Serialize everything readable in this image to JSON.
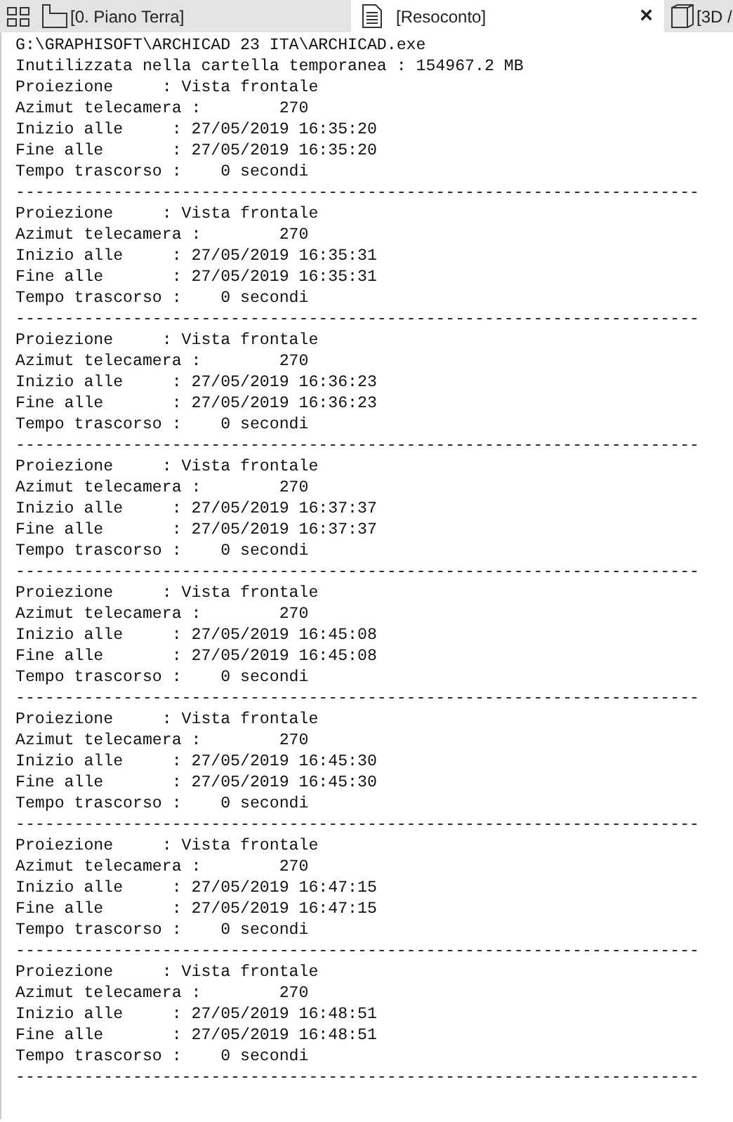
{
  "tabs": [
    {
      "kind": "plan",
      "label": "[0. Piano Terra]",
      "selected": false
    },
    {
      "kind": "report",
      "label": "[Resoconto]",
      "selected": true,
      "close": "×"
    },
    {
      "kind": "view",
      "label": "[3D /",
      "selected": false
    }
  ],
  "report": {
    "lines": [
      "G:\\GRAPHISOFT\\ARCHICAD 23 ITA\\ARCHICAD.exe",
      "Inutilizzata nella cartella temporanea : 154967.2 MB",
      "Proiezione     : Vista frontale",
      "Azimut telecamera :        270",
      "Inizio alle     : 27/05/2019 16:35:20",
      "Fine alle       : 27/05/2019 16:35:20",
      "Tempo trascorso :    0 secondi",
      "----------------------------------------------------------------------",
      "Proiezione     : Vista frontale",
      "Azimut telecamera :        270",
      "Inizio alle     : 27/05/2019 16:35:31",
      "Fine alle       : 27/05/2019 16:35:31",
      "Tempo trascorso :    0 secondi",
      "----------------------------------------------------------------------",
      "Proiezione     : Vista frontale",
      "Azimut telecamera :        270",
      "Inizio alle     : 27/05/2019 16:36:23",
      "Fine alle       : 27/05/2019 16:36:23",
      "Tempo trascorso :    0 secondi",
      "----------------------------------------------------------------------",
      "Proiezione     : Vista frontale",
      "Azimut telecamera :        270",
      "Inizio alle     : 27/05/2019 16:37:37",
      "Fine alle       : 27/05/2019 16:37:37",
      "Tempo trascorso :    0 secondi",
      "----------------------------------------------------------------------",
      "Proiezione     : Vista frontale",
      "Azimut telecamera :        270",
      "Inizio alle     : 27/05/2019 16:45:08",
      "Fine alle       : 27/05/2019 16:45:08",
      "Tempo trascorso :    0 secondi",
      "----------------------------------------------------------------------",
      "Proiezione     : Vista frontale",
      "Azimut telecamera :        270",
      "Inizio alle     : 27/05/2019 16:45:30",
      "Fine alle       : 27/05/2019 16:45:30",
      "Tempo trascorso :    0 secondi",
      "----------------------------------------------------------------------",
      "Proiezione     : Vista frontale",
      "Azimut telecamera :        270",
      "Inizio alle     : 27/05/2019 16:47:15",
      "Fine alle       : 27/05/2019 16:47:15",
      "Tempo trascorso :    0 secondi",
      "----------------------------------------------------------------------",
      "Proiezione     : Vista frontale",
      "Azimut telecamera :        270",
      "Inizio alle     : 27/05/2019 16:48:51",
      "Fine alle       : 27/05/2019 16:48:51",
      "Tempo trascorso :    0 secondi",
      "----------------------------------------------------------------------"
    ]
  }
}
